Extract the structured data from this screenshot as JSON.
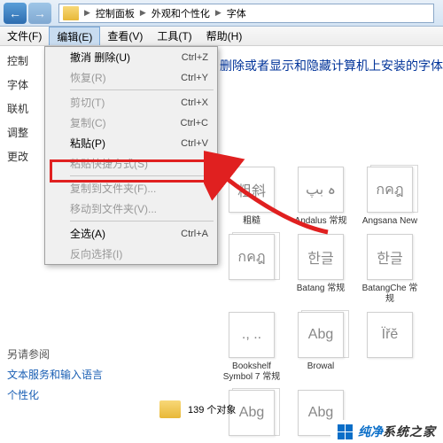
{
  "breadcrumb": {
    "l1": "控制面板",
    "l2": "外观和个性化",
    "l3": "字体"
  },
  "menubar": {
    "file": "文件(F)",
    "edit": "编辑(E)",
    "view": "查看(V)",
    "tools": "工具(T)",
    "help": "帮助(H)"
  },
  "sidebar": {
    "i0": "控制",
    "i1": "字体",
    "i2": "联机",
    "i3": "调整",
    "i4": "更改"
  },
  "sidebottom": {
    "heading": "另请参阅",
    "l1": "文本服务和输入语言",
    "l2": "个性化"
  },
  "dropdown": {
    "undo": "撤消 删除(U)",
    "undo_k": "Ctrl+Z",
    "redo": "恢复(R)",
    "redo_k": "Ctrl+Y",
    "cut": "剪切(T)",
    "cut_k": "Ctrl+X",
    "copy": "复制(C)",
    "copy_k": "Ctrl+C",
    "paste": "粘贴(P)",
    "paste_k": "Ctrl+V",
    "paste_shortcut": "粘贴快捷方式(S)",
    "copyto": "复制到文件夹(F)...",
    "moveto": "移动到文件夹(V)...",
    "selectall": "全选(A)",
    "selectall_k": "Ctrl+A",
    "invert": "反向选择(I)"
  },
  "heading": "删除或者显示和隐藏计算机上安装的字体",
  "fonts": {
    "f0": "粗斜",
    "n0": "粗糙",
    "f1": "ہ بپ",
    "n1": "Andalus 常规",
    "f2": "กคฎ",
    "n2": "Angsana New",
    "f3": "กคฎ",
    "n3": "",
    "f4": "한글",
    "n4": "Batang 常规",
    "f5": "한글",
    "n5": "BatangChe 常规",
    "f6": "., ..",
    "n6": "Bookshelf Symbol 7 常规",
    "f7": "Abg",
    "n7": "Browal",
    "f8": "Ïřĕ",
    "n8": "",
    "f9": "Abg",
    "n9": "",
    "f10": "Abg",
    "n10": ""
  },
  "status": "139 个对象",
  "watermark": {
    "a": "纯净",
    "b": "系统之家"
  }
}
